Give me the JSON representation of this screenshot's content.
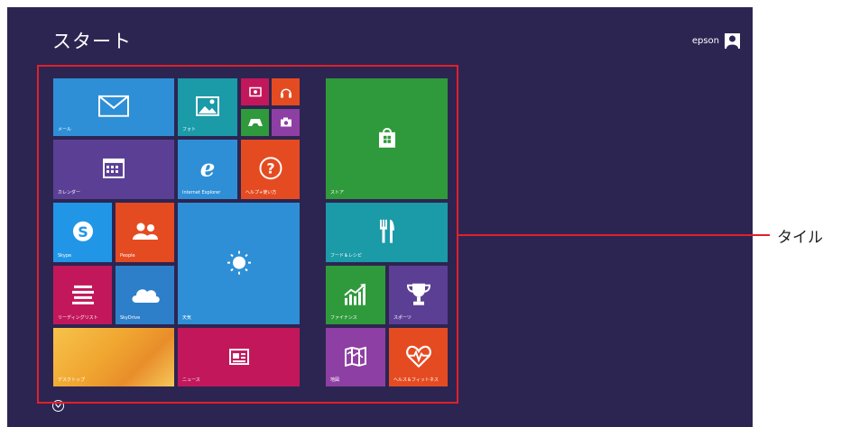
{
  "screen": {
    "title": "スタート",
    "user_name": "epson",
    "background_color": "#2d2551"
  },
  "tiles": {
    "mail": "メール",
    "photos": "フォト",
    "store": "ストア",
    "calendar": "カレンダー",
    "ie": "Internet Explorer",
    "help": "ヘルプ+使い方",
    "skype": "Skype",
    "people": "People",
    "weather": "天気",
    "food": "フード＆レシピ",
    "reading": "リーディングリスト",
    "skydrive": "SkyDrive",
    "finance": "ファイナンス",
    "sports": "スポーツ",
    "desktop": "デスクトップ",
    "news": "ニュース",
    "maps": "地図",
    "health": "ヘルス＆フィットネス"
  },
  "small_tiles": [
    "camera-icon",
    "music-icon",
    "games-icon",
    "camera2-icon"
  ],
  "callout": {
    "label": "タイル",
    "color": "#e0202a"
  }
}
